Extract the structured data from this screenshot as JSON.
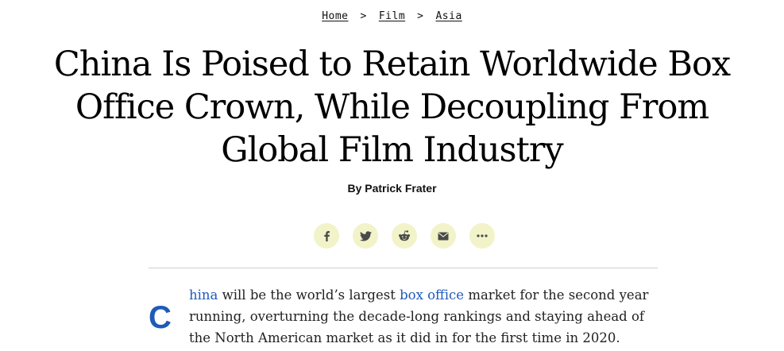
{
  "breadcrumb": {
    "items": [
      "Home",
      "Film",
      "Asia"
    ],
    "separator": ">"
  },
  "headline": {
    "line1": "China Is Poised to Retain Worldwide Box",
    "line2": "Office Crown, While Decoupling From",
    "line3": "Global Film Industry"
  },
  "byline": "By Patrick Frater",
  "share_buttons": [
    {
      "icon": "facebook-icon"
    },
    {
      "icon": "twitter-icon"
    },
    {
      "icon": "reddit-icon"
    },
    {
      "icon": "email-icon"
    },
    {
      "icon": "more-icon"
    }
  ],
  "colors": {
    "link": "#1e5bb8",
    "share_bg": "#f2f3c9",
    "icon": "#4a4a4a"
  },
  "article": {
    "dropcap": "C",
    "link1": "hina",
    "text1": " will be the world’s largest ",
    "link2": "box office",
    "text2": " market for the second year running, overturning the decade-long rankings and staying ahead of the North American market as it did in for the first time in 2020."
  }
}
